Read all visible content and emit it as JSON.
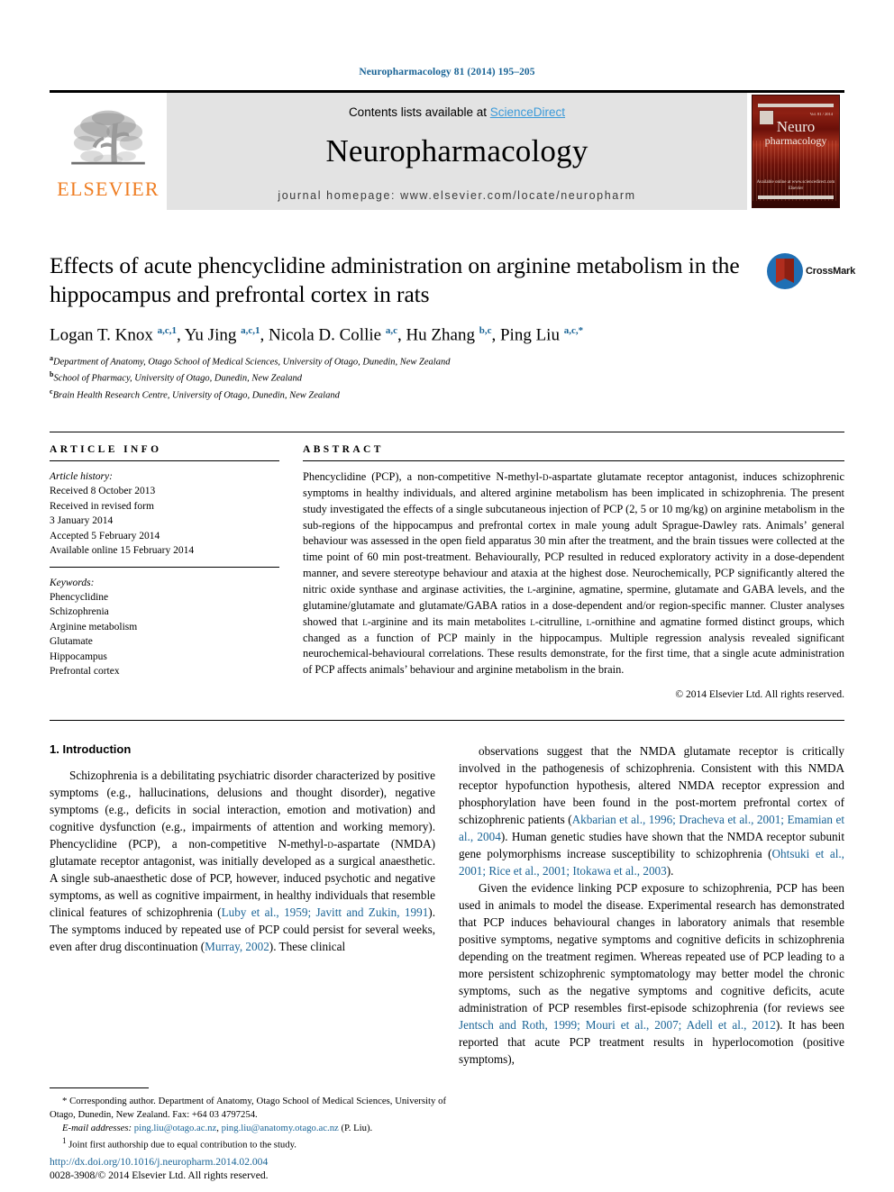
{
  "running_head": "Neuropharmacology 81 (2014) 195–205",
  "masthead": {
    "contents_prefix": "Contents lists available at ",
    "sciencedirect": "ScienceDirect",
    "journal_name": "Neuropharmacology",
    "homepage": "journal homepage: www.elsevier.com/locate/neuropharm",
    "publisher_wordmark": "ELSEVIER",
    "cover": {
      "title_line1": "Neuro",
      "title_line2": "pharmacology",
      "issue_label": "Vol. 81 / 2014",
      "publisher_footer": "Available online at www.sciencedirect.com\nElsevier"
    }
  },
  "article": {
    "title": "Effects of acute phencyclidine administration on arginine metabolism in the hippocampus and prefrontal cortex in rats",
    "crossmark_label": "CrossMark",
    "authors_html": "Logan T. Knox <sup>a,c,1</sup>, Yu Jing <sup>a,c,1</sup>, Nicola D. Collie <sup>a,c</sup>, Hu Zhang <sup>b,c</sup>, Ping Liu <sup>a,c,*</sup>",
    "affiliations": [
      {
        "mark": "a",
        "text": "Department of Anatomy, Otago School of Medical Sciences, University of Otago, Dunedin, New Zealand"
      },
      {
        "mark": "b",
        "text": "School of Pharmacy, University of Otago, Dunedin, New Zealand"
      },
      {
        "mark": "c",
        "text": "Brain Health Research Centre, University of Otago, Dunedin, New Zealand"
      }
    ]
  },
  "article_info": {
    "heading": "ARTICLE INFO",
    "history_label": "Article history:",
    "history": [
      "Received 8 October 2013",
      "Received in revised form",
      "3 January 2014",
      "Accepted 5 February 2014",
      "Available online 15 February 2014"
    ],
    "keywords_label": "Keywords:",
    "keywords": [
      "Phencyclidine",
      "Schizophrenia",
      "Arginine metabolism",
      "Glutamate",
      "Hippocampus",
      "Prefrontal cortex"
    ]
  },
  "abstract": {
    "heading": "ABSTRACT",
    "text_html": "Phencyclidine (PCP), a non-competitive N-methyl-<span class=\"sc\">d</span>-aspartate glutamate receptor antagonist, induces schizophrenic symptoms in healthy individuals, and altered arginine metabolism has been implicated in schizophrenia. The present study investigated the effects of a single subcutaneous injection of PCP (2, 5 or 10 mg/kg) on arginine metabolism in the sub-regions of the hippocampus and prefrontal cortex in male young adult Sprague-Dawley rats. Animals&rsquo; general behaviour was assessed in the open field apparatus 30 min after the treatment, and the brain tissues were collected at the time point of 60 min post-treatment. Behaviourally, PCP resulted in reduced exploratory activity in a dose-dependent manner, and severe stereotype behaviour and ataxia at the highest dose. Neurochemically, PCP significantly altered the nitric oxide synthase and arginase activities, the <span class=\"sc\">l</span>-arginine, agmatine, spermine, glutamate and GABA levels, and the glutamine/glutamate and glutamate/GABA ratios in a dose-dependent and/or region-specific manner. Cluster analyses showed that <span class=\"sc\">l</span>-arginine and its main metabolites <span class=\"sc\">l</span>-citrulline, <span class=\"sc\">l</span>-ornithine and agmatine formed distinct groups, which changed as a function of PCP mainly in the hippocampus. Multiple regression analysis revealed significant neurochemical-behavioural correlations. These results demonstrate, for the first time, that a single acute administration of PCP affects animals&rsquo; behaviour and arginine metabolism in the brain.",
    "copyright": "© 2014 Elsevier Ltd. All rights reserved."
  },
  "introduction": {
    "heading": "1. Introduction",
    "left_paragraphs_html": [
      "Schizophrenia is a debilitating psychiatric disorder characterized by positive symptoms (e.g., hallucinations, delusions and thought disorder), negative symptoms (e.g., deficits in social interaction, emotion and motivation) and cognitive dysfunction (e.g., impairments of attention and working memory). Phencyclidine (PCP), a non-competitive N-methyl-<span class=\"sc\">d</span>-aspartate (NMDA) glutamate receptor antagonist, was initially developed as a surgical anaesthetic. A single sub-anaesthetic dose of PCP, however, induced psychotic and negative symptoms, as well as cognitive impairment, in healthy individuals that resemble clinical features of schizophrenia (<span class=\"cite\">Luby et al., 1959; Javitt and Zukin, 1991</span>). The symptoms induced by repeated use of PCP could persist for several weeks, even after drug discontinuation (<span class=\"cite\">Murray, 2002</span>). These clinical"
    ],
    "right_paragraphs_html": [
      "observations suggest that the NMDA glutamate receptor is critically involved in the pathogenesis of schizophrenia. Consistent with this NMDA receptor hypofunction hypothesis, altered NMDA receptor expression and phosphorylation have been found in the post-mortem prefrontal cortex of schizophrenic patients (<span class=\"cite\">Akbarian et al., 1996; Dracheva et al., 2001; Emamian et al., 2004</span>). Human genetic studies have shown that the NMDA receptor subunit gene polymorphisms increase susceptibility to schizophrenia (<span class=\"cite\">Ohtsuki et al., 2001; Rice et al., 2001; Itokawa et al., 2003</span>).",
      "Given the evidence linking PCP exposure to schizophrenia, PCP has been used in animals to model the disease. Experimental research has demonstrated that PCP induces behavioural changes in laboratory animals that resemble positive symptoms, negative symptoms and cognitive deficits in schizophrenia depending on the treatment regimen. Whereas repeated use of PCP leading to a more persistent schizophrenic symptomatology may better model the chronic symptoms, such as the negative symptoms and cognitive deficits, acute administration of PCP resembles first-episode schizophrenia (for reviews see <span class=\"cite\">Jentsch and Roth, 1999; Mouri et al., 2007; Adell et al., 2012</span>). It has been reported that acute PCP treatment results in hyperlocomotion (positive symptoms),"
    ]
  },
  "footnotes": {
    "corresponding_html": "* Corresponding author. Department of Anatomy, Otago School of Medical Sciences, University of Otago, Dunedin, New Zealand. Fax: +64 03 4797254.",
    "email_html": "<em>E-mail addresses:</em> <span class=\"cite\">ping.liu@otago.ac.nz</span>, <span class=\"cite\">ping.liu@anatomy.otago.ac.nz</span> (P. Liu).",
    "joint_html": "<sup>1</sup> Joint first authorship due to equal contribution to the study."
  },
  "doi_block": {
    "doi": "http://dx.doi.org/10.1016/j.neuropharm.2014.02.004",
    "issn_line": "0028-3908/© 2014 Elsevier Ltd. All rights reserved."
  },
  "colors": {
    "link_blue": "#1a6496",
    "sciencedirect_blue": "#3b9ad9",
    "elsevier_orange": "#ef7d22",
    "crossmark_blue": "#1f6fb4",
    "crossmark_red": "#b02d1e"
  }
}
